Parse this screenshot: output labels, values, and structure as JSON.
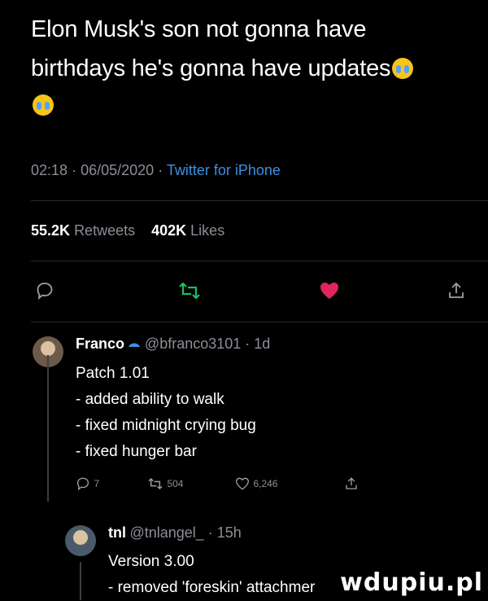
{
  "tweet": {
    "line1": "Elon Musk's son not gonna have",
    "line2": "birthdays he's gonna have updates"
  },
  "meta": {
    "time": "02:18",
    "dot1": "·",
    "date": "06/05/2020",
    "dot2": "·",
    "source": "Twitter for iPhone"
  },
  "stats": {
    "retweets_count": "55.2K",
    "retweets_label": "Retweets",
    "likes_count": "402K",
    "likes_label": "Likes"
  },
  "colors": {
    "retweet_green": "#17bf63",
    "like_red": "#e0245e",
    "link_blue": "#3d8fe0"
  },
  "reply1": {
    "name": "Franco",
    "handle": "@bfranco3101 · 1d",
    "lines": [
      "Patch 1.01",
      "- added ability to walk",
      "- fixed midnight crying bug",
      "- fixed hunger bar"
    ],
    "replies": "7",
    "retweets": "504",
    "likes": "6,246"
  },
  "reply2": {
    "name": "tnl",
    "handle": "@tnlangel_ · 15h",
    "lines": [
      "Version 3.00",
      "- removed 'foreskin' attachmer"
    ]
  },
  "watermark": "wdupiu.pl"
}
